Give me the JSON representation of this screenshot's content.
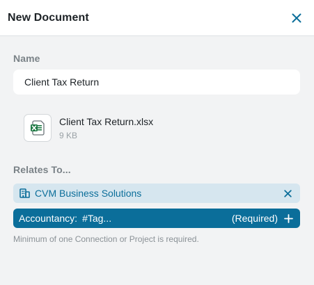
{
  "header": {
    "title": "New Document"
  },
  "form": {
    "name_label": "Name",
    "name_value": "Client Tax Return",
    "file": {
      "name": "Client Tax Return.xlsx",
      "size": "9 KB",
      "icon": "excel-file-icon"
    },
    "relates_label": "Relates To...",
    "connection": {
      "label": "CVM Business Solutions",
      "icon": "building-icon"
    },
    "tag": {
      "category": "Accountancy:",
      "placeholder": "#Tag...",
      "required": "(Required)"
    },
    "helper": "Minimum of one Connection or Project is required."
  },
  "colors": {
    "accent": "#0b6e9a",
    "chip_bg": "#d6e6ef",
    "excel_green": "#1f7a45"
  }
}
